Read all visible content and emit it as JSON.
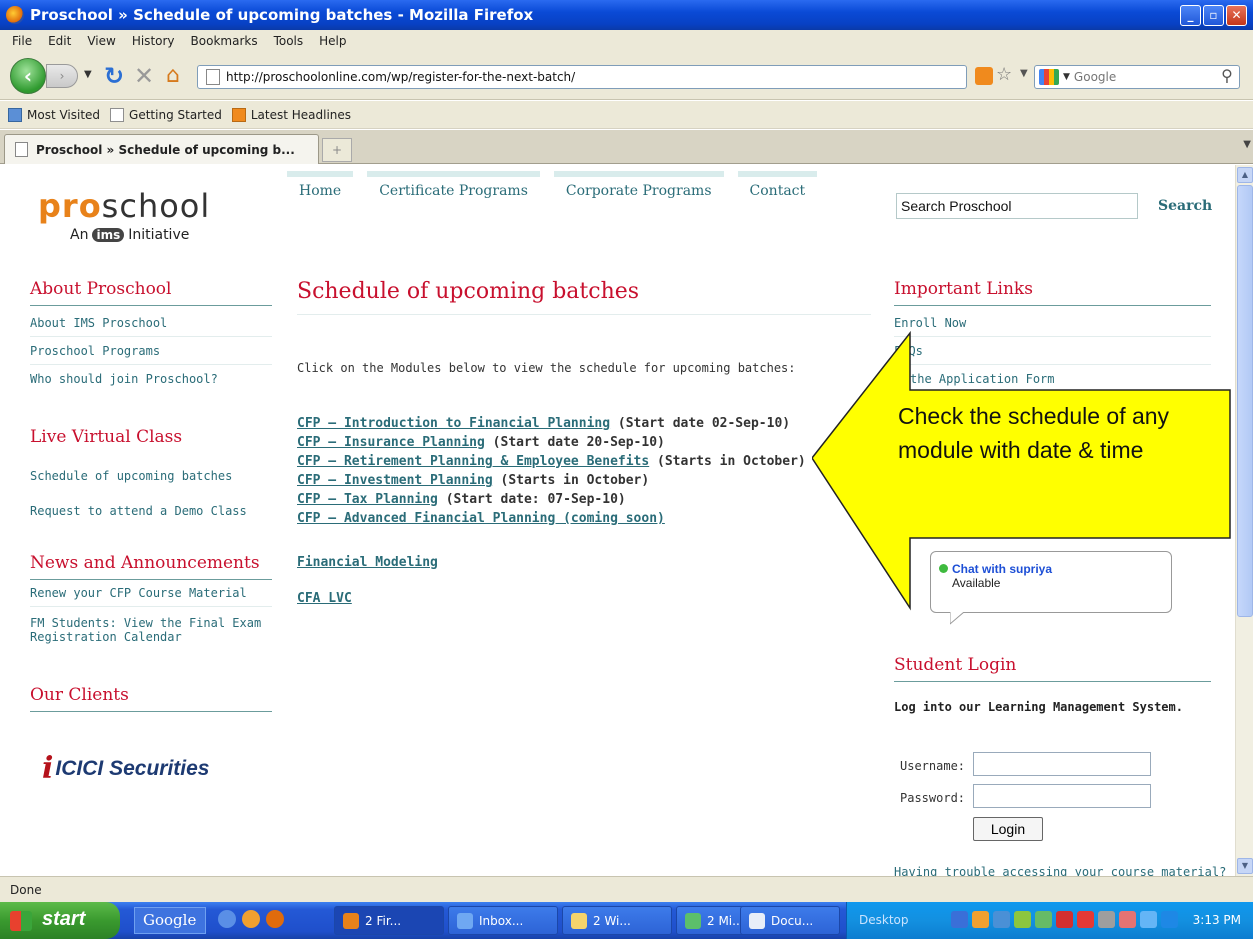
{
  "window": {
    "title": "Proschool » Schedule of upcoming batches - Mozilla Firefox",
    "controls": [
      "_",
      "▫",
      "✕"
    ]
  },
  "menu": [
    "File",
    "Edit",
    "View",
    "History",
    "Bookmarks",
    "Tools",
    "Help"
  ],
  "toolbar": {
    "url": "http://proschoolonline.com/wp/register-for-the-next-batch/",
    "search_placeholder": "Google"
  },
  "bookmarks": [
    "Most Visited",
    "Getting Started",
    "Latest Headlines"
  ],
  "tab": {
    "title": "Proschool » Schedule of upcoming b...",
    "new_tab": "+"
  },
  "site": {
    "logo": {
      "pro": "pro",
      "school": "school",
      "tag_pre": "An",
      "ims": "ims",
      "tag_post": "Initiative"
    },
    "nav": [
      "Home",
      "Certificate Programs",
      "Corporate Programs",
      "Contact"
    ],
    "search_value": "Search Proschool",
    "search_label": "Search"
  },
  "left": {
    "about_title": "About Proschool",
    "about_links": [
      "About IMS Proschool",
      "Proschool Programs",
      "Who should join Proschool?"
    ],
    "lvc_title": "Live Virtual Class",
    "lvc_links": [
      "Schedule of upcoming batches",
      "Request to attend a Demo Class"
    ],
    "news_title": "News and Announcements",
    "news_links": [
      "Renew your CFP Course Material",
      "FM Students: View the Final Exam",
      "Registration Calendar"
    ],
    "clients_title": "Our Clients",
    "client_mark": "i",
    "client_name": "ICICI Securities"
  },
  "main": {
    "title": "Schedule of upcoming batches",
    "intro": "Click on the Modules below to view the schedule for upcoming batches:",
    "courses": [
      {
        "link": "CFP – Introduction to Financial Planning",
        "note": " (Start date 02-Sep-10)"
      },
      {
        "link": "CFP – Insurance Planning",
        "note": " (Start date 20-Sep-10)"
      },
      {
        "link": "CFP – Retirement Planning & Employee Benefits",
        "note": " (Starts in October)"
      },
      {
        "link": "CFP – Investment Planning",
        "note": " (Starts in October)"
      },
      {
        "link": "CFP – Tax Planning",
        "note": " (Start date: 07-Sep-10)"
      },
      {
        "link": "CFP – Advanced Financial Planning (coming soon)",
        "note": ""
      }
    ],
    "financial_modeling": "Financial Modeling",
    "cfa_lvc": "CFA LVC"
  },
  "right": {
    "links_title": "Important Links",
    "links": [
      "Enroll Now",
      "FAQs",
      "the Application Form"
    ],
    "callout": "Check the schedule  of any module with date & time",
    "chat_name": "Chat with supriya",
    "chat_status": "Available",
    "login_title": "Student Login",
    "lms": "Log into our Learning Management System.",
    "username_label": "Username:",
    "password_label": "Password:",
    "login_button": "Login",
    "trouble": "Having trouble accessing your course material?"
  },
  "status": "Done",
  "taskbar": {
    "start": "start",
    "google": "Google",
    "buttons": [
      "2 Fir...",
      "Inbox...",
      "2 Wi...",
      "2 Mi...",
      "Docu..."
    ],
    "desktop": "Desktop",
    "clock": "3:13 PM"
  },
  "colors": {
    "accent_teal": "#2a6c78",
    "heading_red": "#c8102e",
    "callout_yellow": "#ffff00"
  }
}
